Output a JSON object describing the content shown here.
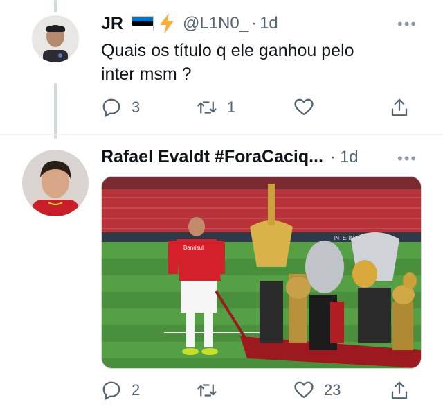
{
  "tweets": [
    {
      "author": "JR",
      "handle": "@L1N0_",
      "separator": "·",
      "time": "1d",
      "more": "•••",
      "text_lines": [
        "Quais os título q ele ganhou pelo",
        "inter msm ?"
      ],
      "reply_count": "3",
      "retweet_count": "1",
      "like_count": "",
      "flag_colors": [
        "#0072ce",
        "#000000",
        "#ffffff"
      ],
      "badge_icon": "lightning-icon",
      "badge_color": "#ffac33"
    },
    {
      "author": "Rafael Evaldt #ForaCaciq...",
      "separator": "·",
      "time": "1d",
      "more": "•••",
      "reply_count": "2",
      "retweet_count": "",
      "like_count": "23",
      "media": {
        "shirt_text": "Banrisul",
        "banner_text": "INTERNACIONAL",
        "kit_color": "#d4202a"
      }
    }
  ],
  "colors": {
    "text": "#0f1419",
    "secondary": "#536471",
    "thread_line": "#cfd9de"
  }
}
